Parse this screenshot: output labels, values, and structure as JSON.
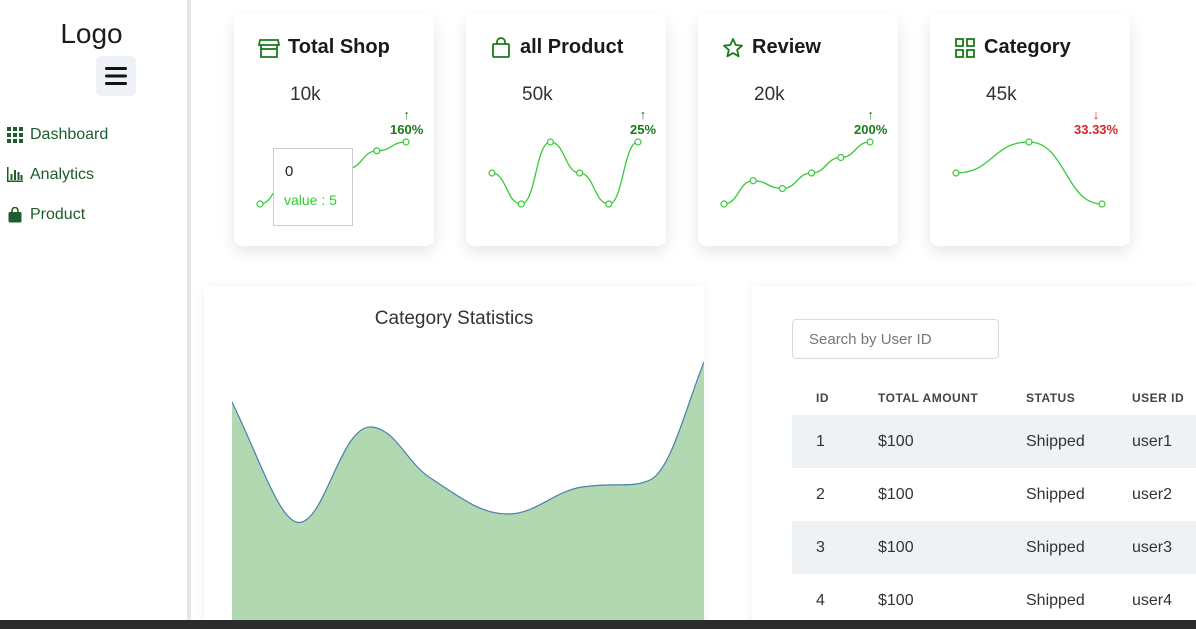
{
  "sidebar": {
    "logo": "Logo",
    "menu_icon": "hamburger-icon",
    "items": [
      {
        "label": "Dashboard",
        "icon": "grid-icon"
      },
      {
        "label": "Analytics",
        "icon": "bar-chart-icon"
      },
      {
        "label": "Product",
        "icon": "bag-icon"
      }
    ]
  },
  "cards": [
    {
      "title": "Total Shop",
      "icon": "store-icon",
      "value": "10k",
      "change": "160%",
      "direction": "up",
      "color": "#1a7a1a",
      "points": [
        5,
        8,
        6,
        9,
        11,
        12
      ]
    },
    {
      "title": "all Product",
      "icon": "bag-icon",
      "value": "50k",
      "change": "25%",
      "direction": "up",
      "color": "#1a7a1a",
      "points": [
        6,
        4,
        8,
        6,
        4,
        8
      ]
    },
    {
      "title": "Review",
      "icon": "star-icon",
      "value": "20k",
      "change": "200%",
      "direction": "up",
      "color": "#1a7a1a",
      "points": [
        2,
        5,
        4,
        6,
        8,
        10
      ]
    },
    {
      "title": "Category",
      "icon": "grid-outline-icon",
      "value": "45k",
      "change": "33.33%",
      "direction": "down",
      "color": "#d62828",
      "points": [
        6,
        8,
        4
      ]
    }
  ],
  "tooltip": {
    "label": "0",
    "value_text": "value : 5"
  },
  "stats": {
    "title": "Category Statistics"
  },
  "table": {
    "search_placeholder": "Search by User ID",
    "headers": [
      "ID",
      "TOTAL AMOUNT",
      "STATUS",
      "USER ID"
    ],
    "rows": [
      [
        "1",
        "$100",
        "Shipped",
        "user1"
      ],
      [
        "2",
        "$100",
        "Shipped",
        "user2"
      ],
      [
        "3",
        "$100",
        "Shipped",
        "user3"
      ],
      [
        "4",
        "$100",
        "Shipped",
        "user4"
      ]
    ]
  },
  "colors": {
    "accent_green": "#33cc33",
    "nav_text": "#1f5c2e",
    "area_fill": "#b2d8b2",
    "area_stroke": "#4a7fb0",
    "row_alt": "#eef2f5"
  }
}
